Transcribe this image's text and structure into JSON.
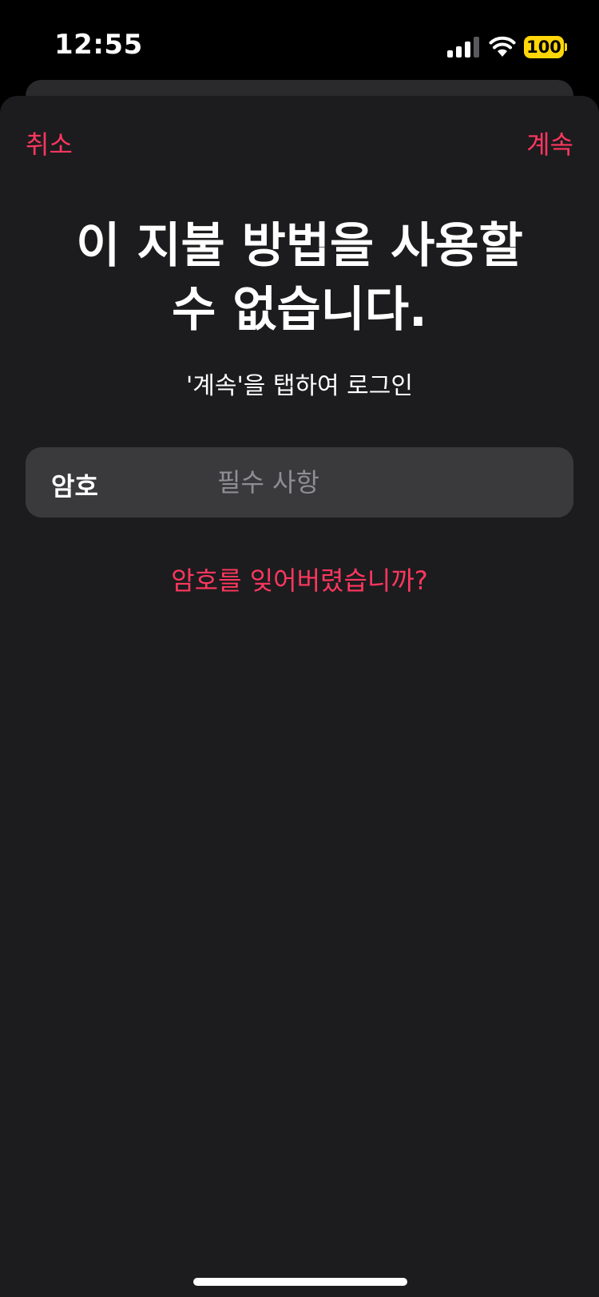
{
  "status_bar": {
    "time": "12:55",
    "battery_level": "100",
    "signal_icon": "cellular-signal-icon",
    "wifi_icon": "wifi-icon",
    "battery_color": "#ffd60a"
  },
  "nav": {
    "cancel_label": "취소",
    "continue_label": "계속"
  },
  "title": {
    "line1": "이 지불 방법을 사용할",
    "line2": "수 없습니다."
  },
  "subtitle": "'계속'을 탭하여 로그인",
  "password_field": {
    "label": "암호",
    "value": "",
    "placeholder": "필수 사항"
  },
  "forgot_password_label": "암호를 잊어버렸습니까?",
  "colors": {
    "accent": "#ff375f",
    "sheet_background": "#1c1c1e",
    "field_background": "#3a3a3c"
  }
}
